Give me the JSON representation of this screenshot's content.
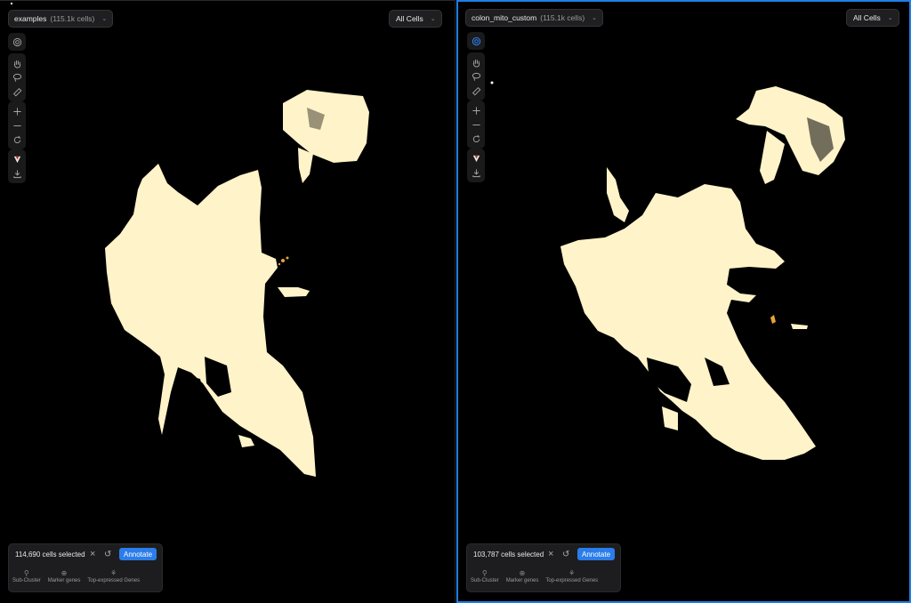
{
  "colors": {
    "accent": "#2b7de9",
    "cells": "#fff3c9",
    "background": "#000000"
  },
  "left_panel": {
    "dataset": {
      "name": "examples",
      "count": "(115.1k cells)"
    },
    "filter": {
      "label": "All Cells"
    },
    "selection": {
      "text": "114,690 cells selected",
      "annotate_label": "Annotate"
    },
    "actions": [
      {
        "label": "Sub-Cluster"
      },
      {
        "label": "Marker genes"
      },
      {
        "label": "Top-expressed Genes"
      }
    ]
  },
  "right_panel": {
    "dataset": {
      "name": "colon_mito_custom",
      "count": "(115.1k cells)"
    },
    "filter": {
      "label": "All Cells"
    },
    "selection": {
      "text": "103,787 cells selected",
      "annotate_label": "Annotate"
    },
    "actions": [
      {
        "label": "Sub-Cluster"
      },
      {
        "label": "Marker genes"
      },
      {
        "label": "Top-expressed Genes"
      }
    ]
  },
  "toolbar_icons": [
    "target-icon",
    "hand-icon",
    "lasso-icon",
    "ruler-icon",
    "zoom-in-icon",
    "zoom-out-icon",
    "reset-icon",
    "logo-icon",
    "download-icon"
  ]
}
